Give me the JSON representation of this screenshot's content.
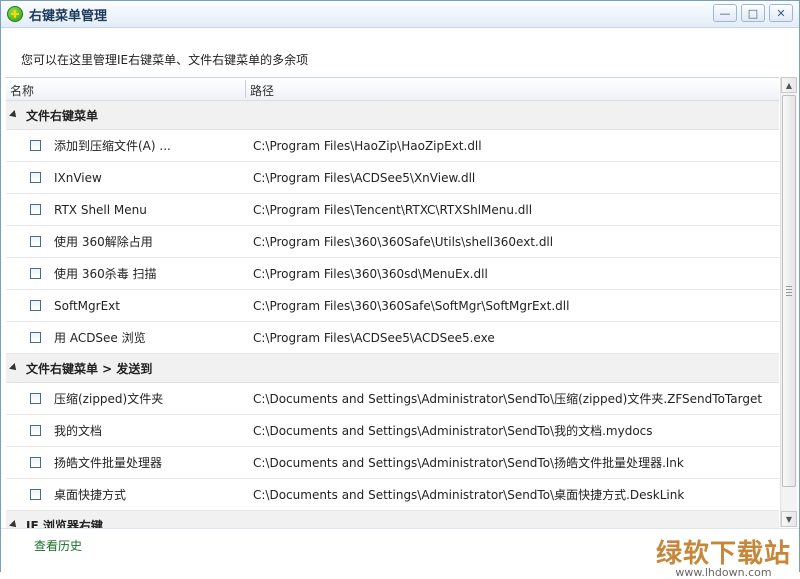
{
  "window": {
    "title": "右键菜单管理",
    "buttons": {
      "minimize": "—",
      "maximize": "□",
      "close": "✕"
    }
  },
  "description": "您可以在这里管理IE右键菜单、文件右键菜单的多余项",
  "columns": {
    "name": "名称",
    "path": "路径"
  },
  "groups": [
    {
      "label": "文件右键菜单",
      "items": [
        {
          "name": "添加到压缩文件(A) ...",
          "path": "C:\\Program Files\\HaoZip\\HaoZipExt.dll"
        },
        {
          "name": "IXnView",
          "path": "C:\\Program Files\\ACDSee5\\XnView.dll"
        },
        {
          "name": "RTX Shell Menu",
          "path": "C:\\Program Files\\Tencent\\RTXC\\RTXShlMenu.dll"
        },
        {
          "name": "使用 360解除占用",
          "path": "C:\\Program Files\\360\\360Safe\\Utils\\shell360ext.dll"
        },
        {
          "name": "使用 360杀毒 扫描",
          "path": "C:\\Program Files\\360\\360sd\\MenuEx.dll"
        },
        {
          "name": "SoftMgrExt",
          "path": "C:\\Program Files\\360\\360Safe\\SoftMgr\\SoftMgrExt.dll"
        },
        {
          "name": "用 ACDSee 浏览",
          "path": "C:\\Program Files\\ACDSee5\\ACDSee5.exe"
        }
      ]
    },
    {
      "label": "文件右键菜单 > 发送到",
      "items": [
        {
          "name": "压缩(zipped)文件夹",
          "path": "C:\\Documents and Settings\\Administrator\\SendTo\\压缩(zipped)文件夹.ZFSendToTarget"
        },
        {
          "name": "我的文档",
          "path": "C:\\Documents and Settings\\Administrator\\SendTo\\我的文档.mydocs"
        },
        {
          "name": "扬皓文件批量处理器",
          "path": "C:\\Documents and Settings\\Administrator\\SendTo\\扬皓文件批量处理器.lnk"
        },
        {
          "name": "桌面快捷方式",
          "path": "C:\\Documents and Settings\\Administrator\\SendTo\\桌面快捷方式.DeskLink"
        }
      ]
    },
    {
      "label": "IE 浏览器右键",
      "items": []
    }
  ],
  "footer": {
    "history_link": "查看历史",
    "watermark_big": "绿软下载站",
    "watermark_small": "www.lhdown.com"
  }
}
